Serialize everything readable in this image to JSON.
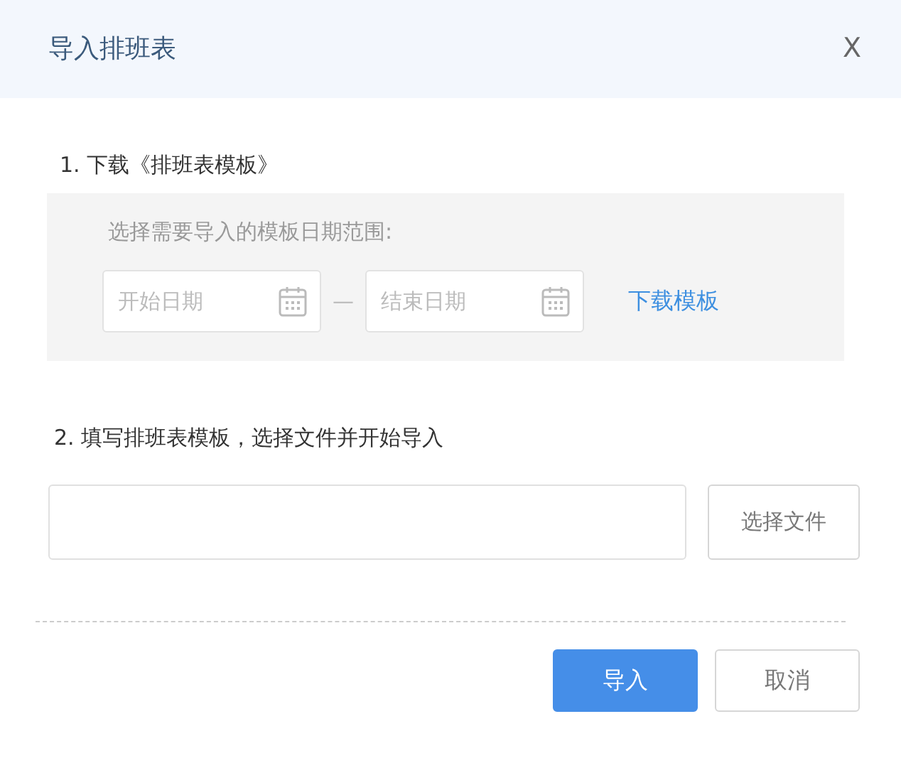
{
  "dialog": {
    "title": "导入排班表",
    "close": "X"
  },
  "step1": {
    "label": "1.  下载《排班表模板》",
    "hint": "选择需要导入的模板日期范围:",
    "start_date": {
      "placeholder": "开始日期"
    },
    "separator": "—",
    "end_date": {
      "placeholder": "结束日期"
    },
    "download_link": "下载模板"
  },
  "step2": {
    "label": "2. 填写排班表模板，选择文件并开始导入",
    "choose_button": "选择文件"
  },
  "buttons": [
    {
      "label": "导入",
      "kind": "primary"
    },
    {
      "label": "取消",
      "kind": "secondary"
    }
  ]
}
